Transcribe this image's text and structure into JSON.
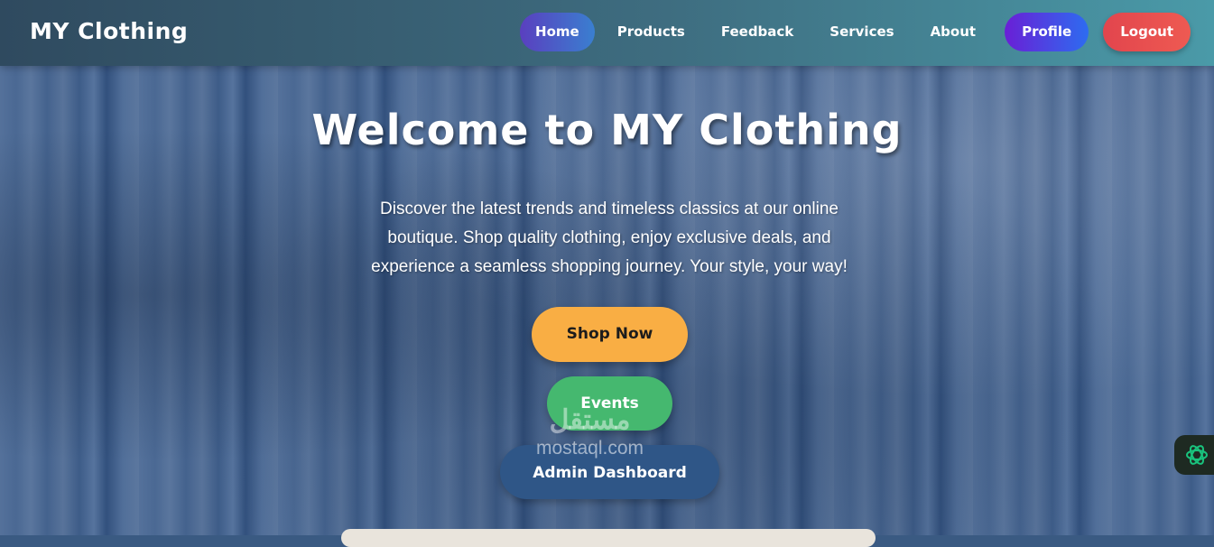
{
  "navbar": {
    "brand": "MY Clothing",
    "links": [
      "Home",
      "Products",
      "Feedback",
      "Services",
      "About"
    ],
    "profile_label": "Profile",
    "logout_label": "Logout"
  },
  "hero": {
    "title": "Welcome to MY Clothing",
    "description": "Discover the latest trends and timeless classics at our online boutique. Shop quality clothing, enjoy exclusive deals, and experience a seamless shopping journey. Your style, your way!",
    "shop_label": "Shop Now",
    "events_label": "Events",
    "admin_label": "Admin Dashboard"
  },
  "watermark": {
    "arabic": "مستقل",
    "site": "mostaql.com"
  },
  "icons": {
    "assistant": "openai-logo-icon"
  },
  "colors": {
    "shop_button": "#f9ae44",
    "events_button": "#45b86f",
    "admin_button": "#2f5687",
    "logout_button": "#e2454d",
    "profile_button": "#6a1fd6"
  }
}
